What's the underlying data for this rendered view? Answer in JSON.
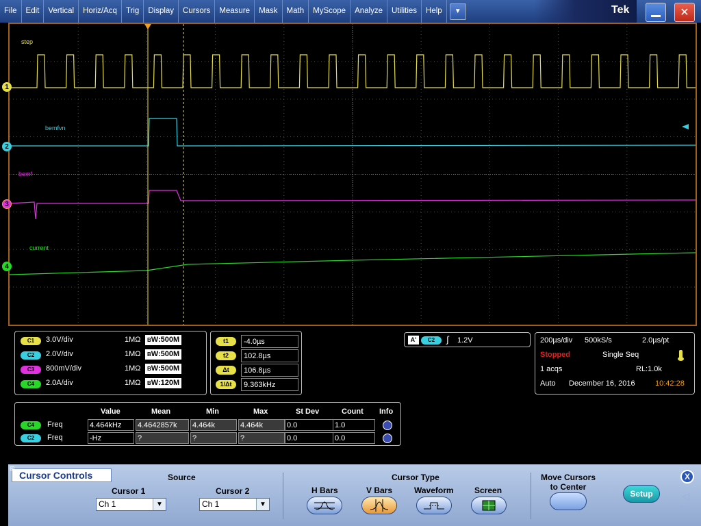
{
  "menu": [
    "File",
    "Edit",
    "Vertical",
    "Horiz/Acq",
    "Trig",
    "Display",
    "Cursors",
    "Measure",
    "Mask",
    "Math",
    "MyScope",
    "Analyze",
    "Utilities",
    "Help"
  ],
  "menu_dropdown_icon": "triangle-down-icon",
  "brand": "Tek",
  "window_buttons": {
    "minimize_icon": "minimize-icon",
    "close_icon": "close-icon"
  },
  "channels": {
    "ch1": {
      "label": "step",
      "color": "#e8e048",
      "marker": "1"
    },
    "ch2": {
      "label": "bemfvn",
      "color": "#38d0e0",
      "marker": "2"
    },
    "ch3": {
      "label": "bemf",
      "color": "#e030e0",
      "marker": "3"
    },
    "ch4": {
      "label": "current",
      "color": "#28d828",
      "marker": "4"
    }
  },
  "vertical": [
    {
      "pill": "C1",
      "scale": "3.0V/div",
      "imp": "1MΩ",
      "bw": "W:500M",
      "color": "#e8e048"
    },
    {
      "pill": "C2",
      "scale": "2.0V/div",
      "imp": "1MΩ",
      "bw": "W:500M",
      "color": "#38d0e0"
    },
    {
      "pill": "C3",
      "scale": "800mV/div",
      "imp": "1MΩ",
      "bw": "W:500M",
      "color": "#e030e0"
    },
    {
      "pill": "C4",
      "scale": "2.0A/div",
      "imp": "1MΩ",
      "bw": "W:120M",
      "color": "#28d828"
    }
  ],
  "bw_prefix": "B",
  "cursors": [
    {
      "pill": "t1",
      "value": "-4.0µs"
    },
    {
      "pill": "t2",
      "value": "102.8µs"
    },
    {
      "pill": "Δt",
      "value": "106.8µs"
    },
    {
      "pill": "1/Δt",
      "value": "9.363kHz"
    }
  ],
  "trigger": {
    "a_label": "A'",
    "source": "C2",
    "level": "1.2V"
  },
  "horizontal": {
    "timebase": "200µs/div",
    "sample_rate": "500kS/s",
    "resolution": "2.0µs/pt",
    "status": "Stopped",
    "mode": "Single Seq",
    "acqs": "1 acqs",
    "record_length": "RL:1.0k",
    "trigger_mode": "Auto",
    "date": "December 16, 2016",
    "time": "10:42:28"
  },
  "measurements": {
    "headers": [
      "Value",
      "Mean",
      "Min",
      "Max",
      "St Dev",
      "Count",
      "Info"
    ],
    "rows": [
      {
        "ch": "C4",
        "name": "Freq",
        "value": "4.464kHz",
        "mean": "4.4642857k",
        "min": "4.464k",
        "max": "4.464k",
        "stdev": "0.0",
        "count": "1.0",
        "color": "#28d828"
      },
      {
        "ch": "C2",
        "name": "Freq",
        "value": "-Hz",
        "mean": "?",
        "min": "?",
        "max": "?",
        "stdev": "0.0",
        "count": "0.0",
        "color": "#38d0e0"
      }
    ]
  },
  "cursor_controls": {
    "title": "Cursor Controls",
    "source_label": "Source",
    "cursor1_label": "Cursor 1",
    "cursor2_label": "Cursor 2",
    "cursor1_value": "Ch 1",
    "cursor2_value": "Ch 1",
    "type_label": "Cursor Type",
    "types": [
      "H Bars",
      "V Bars",
      "Waveform",
      "Screen"
    ],
    "selected_type": "V Bars",
    "move_label": "Move Cursors to Center",
    "setup_label": "Setup"
  }
}
